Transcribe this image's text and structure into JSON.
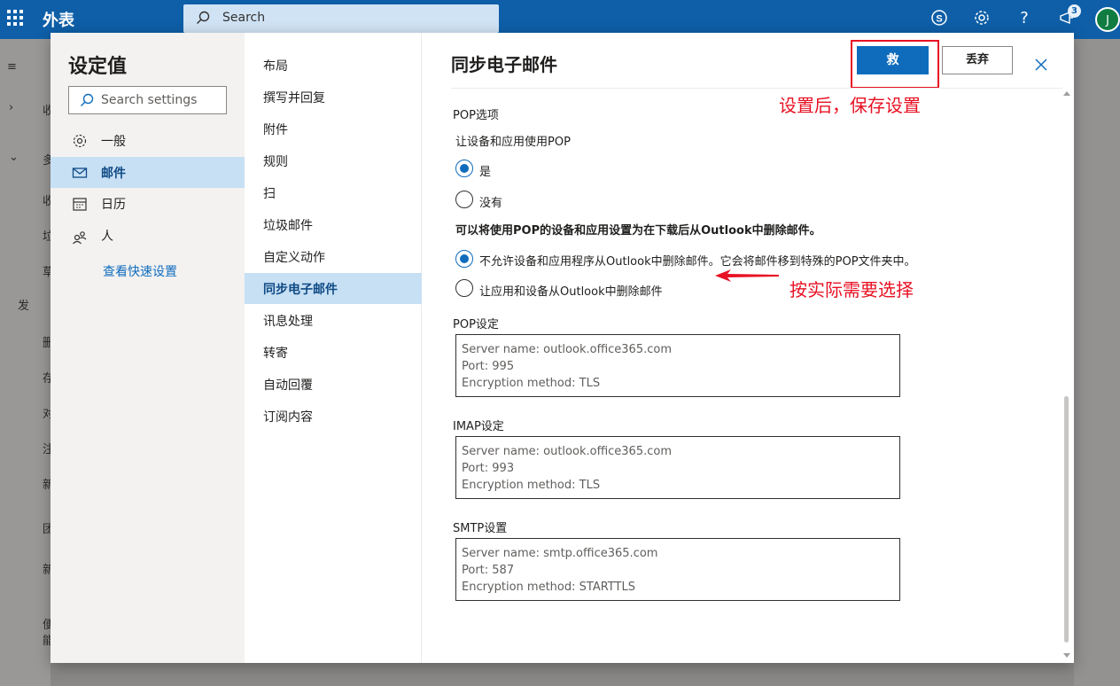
{
  "app": {
    "title": "外表",
    "search_placeholder": "Search",
    "notification_count": "3",
    "avatar_initial": "J"
  },
  "background_sidebar": {
    "fragments": [
      "收",
      "多",
      "收",
      "垃",
      "草",
      "发",
      "删",
      "存",
      "对",
      "注",
      "新",
      "团",
      "新",
      "便",
      "能"
    ]
  },
  "settings": {
    "title": "设定值",
    "search_placeholder": "Search settings",
    "categories": [
      {
        "label": "一般",
        "icon": "gear-icon"
      },
      {
        "label": "邮件",
        "icon": "mail-icon",
        "active": true
      },
      {
        "label": "日历",
        "icon": "calendar-icon"
      },
      {
        "label": "人",
        "icon": "people-icon"
      }
    ],
    "quick_settings_link": "查看快速设置",
    "subcategories": [
      "布局",
      "撰写并回复",
      "附件",
      "规则",
      "扫",
      "垃圾邮件",
      "自定义动作",
      "同步电子邮件",
      "讯息处理",
      "转寄",
      "自动回覆",
      "订阅内容"
    ],
    "active_subcategory": "同步电子邮件"
  },
  "pane": {
    "title": "同步电子邮件",
    "save_label": "救",
    "discard_label": "丢弃",
    "pop_options_heading": "POP选项",
    "allow_pop_question": "让设备和应用使用POP",
    "allow_pop_yes": "是",
    "allow_pop_no": "没有",
    "delete_question": "可以将使用POP的设备和应用设置为在下载后从Outlook中删除邮件。",
    "delete_option_1": "不允许设备和应用程序从Outlook中删除邮件。它会将邮件移到特殊的POP文件夹中。",
    "delete_option_2": "让应用和设备从Outlook中删除邮件",
    "pop_settings_heading": "POP设定",
    "pop_settings": [
      "Server name: outlook.office365.com",
      "Port: 995",
      "Encryption method: TLS"
    ],
    "imap_settings_heading": "IMAP设定",
    "imap_settings": [
      "Server name: outlook.office365.com",
      "Port: 993",
      "Encryption method: TLS"
    ],
    "smtp_settings_heading": "SMTP设置",
    "smtp_settings": [
      "Server name: smtp.office365.com",
      "Port: 587",
      "Encryption method: STARTTLS"
    ]
  },
  "annotations": {
    "save_note": "设置后，保存设置",
    "choose_note": "按实际需要选择",
    "color": "#e81123"
  },
  "colors": {
    "brand_blue": "#0e5fa8",
    "accent": "#0f6cbd",
    "selected_bg": "#c7e0f4"
  }
}
